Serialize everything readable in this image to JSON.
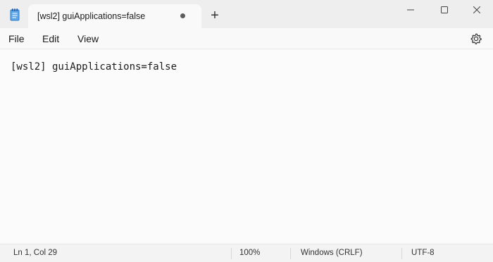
{
  "tab": {
    "title": "[wsl2] guiApplications=false",
    "unsaved_indicator": "●",
    "new_tab_label": "+"
  },
  "window_controls": {
    "minimize_icon": "minimize-icon",
    "maximize_icon": "maximize-icon",
    "close_icon": "close-icon"
  },
  "menu": {
    "file": "File",
    "edit": "Edit",
    "view": "View",
    "settings_icon": "gear-icon"
  },
  "editor": {
    "content": "[wsl2] guiApplications=false"
  },
  "status": {
    "position": "Ln 1, Col 29",
    "zoom": "100%",
    "line_ending": "Windows (CRLF)",
    "encoding": "UTF-8"
  },
  "colors": {
    "titlebar_bg": "#eeeeee",
    "editor_bg": "#fbfbfb",
    "app_icon_accent": "#2b7cd3"
  }
}
